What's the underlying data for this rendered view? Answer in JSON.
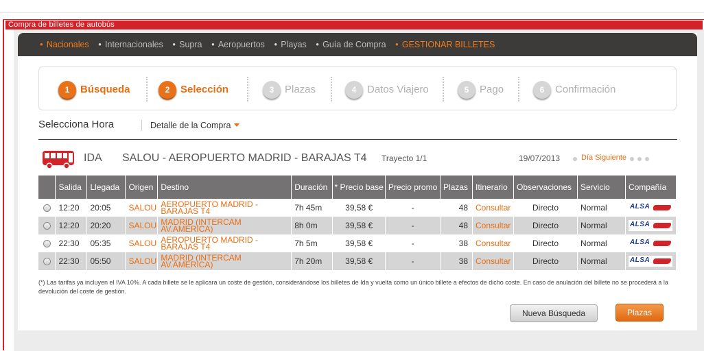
{
  "window_title": "Compra de billetes de autobús",
  "nav": {
    "items": [
      {
        "label": "Nacionales",
        "active": true
      },
      {
        "label": "Internacionales",
        "active": false
      },
      {
        "label": "Supra",
        "active": false
      },
      {
        "label": "Aeropuertos",
        "active": false
      },
      {
        "label": "Playas",
        "active": false
      },
      {
        "label": "Guía de Compra",
        "active": false
      },
      {
        "label": "GESTIONAR BILLETES",
        "active": true
      }
    ]
  },
  "steps": [
    {
      "num": "1",
      "label": "Búsqueda",
      "active": true
    },
    {
      "num": "2",
      "label": "Selección",
      "active": true
    },
    {
      "num": "3",
      "label": "Plazas",
      "active": false
    },
    {
      "num": "4",
      "label": "Datos Viajero",
      "active": false
    },
    {
      "num": "5",
      "label": "Pago",
      "active": false
    },
    {
      "num": "6",
      "label": "Confirmación",
      "active": false
    }
  ],
  "section": {
    "title": "Selecciona Hora",
    "detail_link": "Detalle de la Compra"
  },
  "journey": {
    "direction": "IDA",
    "route": "SALOU - AEROPUERTO MADRID - BARAJAS T4",
    "trayecto": "Trayecto 1/1",
    "date": "19/07/2013",
    "next_day": "Día Siguiente",
    "icon": "bus-icon"
  },
  "table": {
    "headers": [
      "",
      "Salida",
      "Llegada",
      "Origen",
      "Destino",
      "Duración",
      "* Precio base",
      "Precio promo",
      "Plazas",
      "Itinerario",
      "Observaciones",
      "Servicio",
      "Compañía"
    ],
    "rows": [
      {
        "salida": "12:20",
        "llegada": "20:05",
        "origen": "SALOU",
        "destino": "AEROPUERTO MADRID - BARAJAS T4",
        "duracion": "7h 45m",
        "precio": "39,58 €",
        "promo": "-",
        "plazas": "48",
        "itinerario": "Consultar",
        "observaciones": "Directo",
        "servicio": "Normal",
        "compania": "ALSA"
      },
      {
        "salida": "12:20",
        "llegada": "20:20",
        "origen": "SALOU",
        "destino": "MADRID (INTERCAM AV.AMERICA)",
        "duracion": "8h 0m",
        "precio": "39,58 €",
        "promo": "-",
        "plazas": "48",
        "itinerario": "Consultar",
        "observaciones": "Directo",
        "servicio": "Normal",
        "compania": "ALSA"
      },
      {
        "salida": "22:30",
        "llegada": "05:35",
        "origen": "SALOU",
        "destino": "AEROPUERTO MADRID - BARAJAS T4",
        "duracion": "7h 5m",
        "precio": "39,58 €",
        "promo": "-",
        "plazas": "38",
        "itinerario": "Consultar",
        "observaciones": "Directo",
        "servicio": "Normal",
        "compania": "ALSA"
      },
      {
        "salida": "22:30",
        "llegada": "05:50",
        "origen": "SALOU",
        "destino": "MADRID (INTERCAM AV.AMERICA)",
        "duracion": "7h 20m",
        "precio": "39,58 €",
        "promo": "-",
        "plazas": "38",
        "itinerario": "Consultar",
        "observaciones": "Directo",
        "servicio": "Normal",
        "compania": "ALSA"
      }
    ]
  },
  "note": "(*) Las tarifas ya incluyen el IVA 10%. A cada billete se le aplicara un coste de gestión, considerándose los billetes de Ida y vuelta como un único billete a efectos de dicho coste. En caso de anulación del billete no se procederá a la devolución del coste de gestión.",
  "buttons": {
    "nueva_busqueda": "Nueva Búsqueda",
    "plazas": "Plazas"
  },
  "colors": {
    "accent": "#e96e12",
    "brand_red": "#d2232a",
    "nav_bg": "#3d3b39",
    "header_bg": "#747272"
  }
}
